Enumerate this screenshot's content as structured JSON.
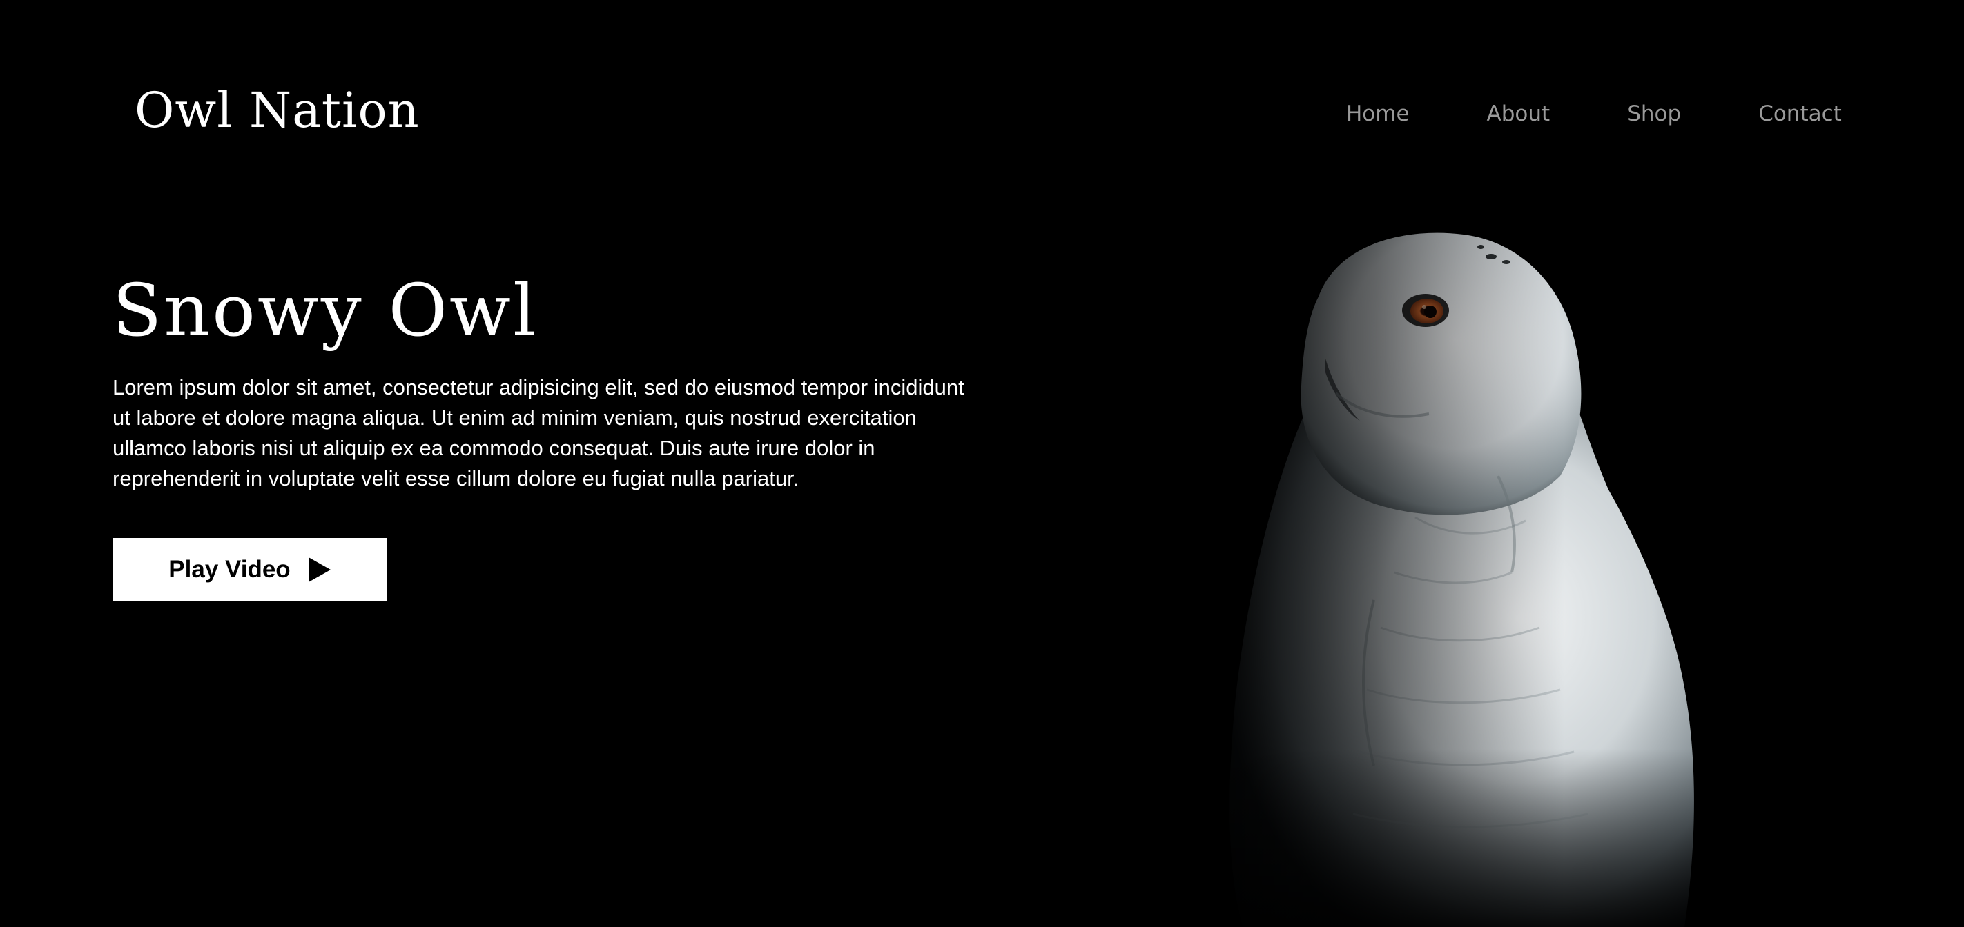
{
  "brand": {
    "name": "Owl Nation"
  },
  "nav": {
    "items": [
      {
        "label": "Home"
      },
      {
        "label": "About"
      },
      {
        "label": "Shop"
      },
      {
        "label": "Contact"
      }
    ]
  },
  "hero": {
    "title": "Snowy Owl",
    "description": "Lorem ipsum dolor sit amet, consectetur adipisicing elit, sed do eiusmod tempor incididunt ut labore et dolore magna aliqua. Ut enim ad minim veniam, quis nostrud exercitation ullamco laboris nisi ut aliquip ex ea commodo consequat. Duis aute irure dolor in reprehenderit in voluptate velit esse cillum dolore eu fugiat nulla pariatur.",
    "button_label": "Play Video",
    "button_icon": "play-icon"
  },
  "image": {
    "subject": "snowy-owl-photo"
  },
  "colors": {
    "background": "#000000",
    "text": "#ffffff",
    "nav_text": "#9a9a9a",
    "button_bg": "#ffffff",
    "button_text": "#000000",
    "owl_eye": "#c8642c"
  }
}
